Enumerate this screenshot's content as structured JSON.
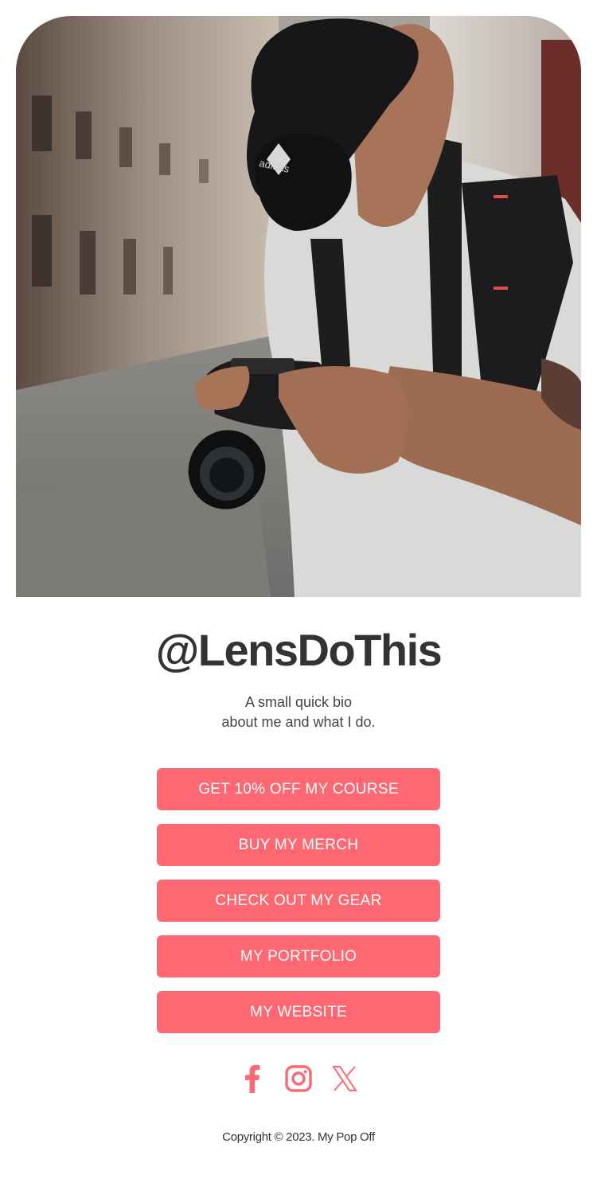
{
  "profile": {
    "handle": "@LensDoThis",
    "bio_line1": "A small quick bio",
    "bio_line2": "about me and what I do."
  },
  "links": [
    {
      "label": "GET 10% OFF MY COURSE"
    },
    {
      "label": "BUY MY MERCH"
    },
    {
      "label": "CHECK OUT MY GEAR"
    },
    {
      "label": "MY PORTFOLIO"
    },
    {
      "label": "MY WEBSITE"
    }
  ],
  "socials": [
    {
      "icon": "facebook-icon"
    },
    {
      "icon": "instagram-icon"
    },
    {
      "icon": "x-icon"
    }
  ],
  "footer": {
    "copyright": "Copyright © 2023. My Pop Off"
  },
  "colors": {
    "accent": "#fd6873",
    "text": "#333333",
    "background": "#ffffff"
  }
}
